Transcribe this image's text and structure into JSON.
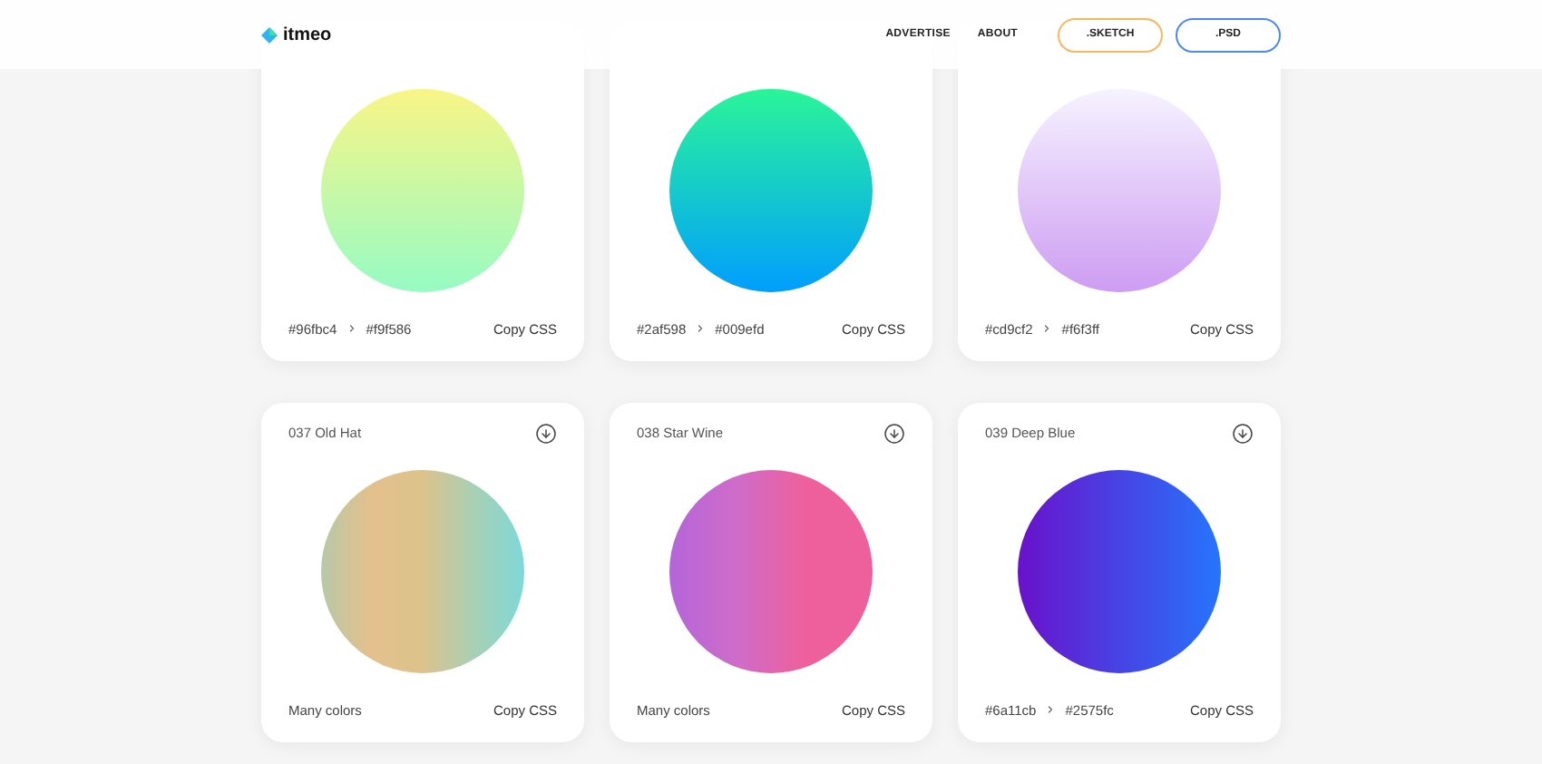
{
  "header": {
    "logo": "itmeo",
    "nav": [
      "ADVERTISE",
      "ABOUT"
    ],
    "buttons": [
      {
        "label": ".SKETCH",
        "color": "#f9b661"
      },
      {
        "label": ".PSD",
        "color": "#4b88f7"
      }
    ]
  },
  "cards": [
    {
      "kind": "pair",
      "vertical": true,
      "first_at_end": true,
      "colors": [
        "#96fbc4",
        "#f9f586"
      ],
      "copy": "Copy CSS"
    },
    {
      "kind": "pair",
      "vertical": true,
      "first_at_end": false,
      "colors": [
        "#2af598",
        "#009efd"
      ],
      "copy": "Copy CSS"
    },
    {
      "kind": "pair",
      "vertical": true,
      "first_at_end": true,
      "colors": [
        "#cd9cf2",
        "#f6f3ff"
      ],
      "copy": "Copy CSS"
    },
    {
      "kind": "multi",
      "title": "037 Old Hat",
      "note": "Many colors",
      "copy": "Copy CSS"
    },
    {
      "kind": "multi",
      "title": "038 Star Wine",
      "note": "Many colors",
      "copy": "Copy CSS"
    },
    {
      "kind": "pair",
      "title": "039 Deep Blue",
      "vertical": false,
      "first_at_end": false,
      "colors": [
        "#6a11cb",
        "#2575fc"
      ],
      "copy": "Copy CSS"
    }
  ]
}
